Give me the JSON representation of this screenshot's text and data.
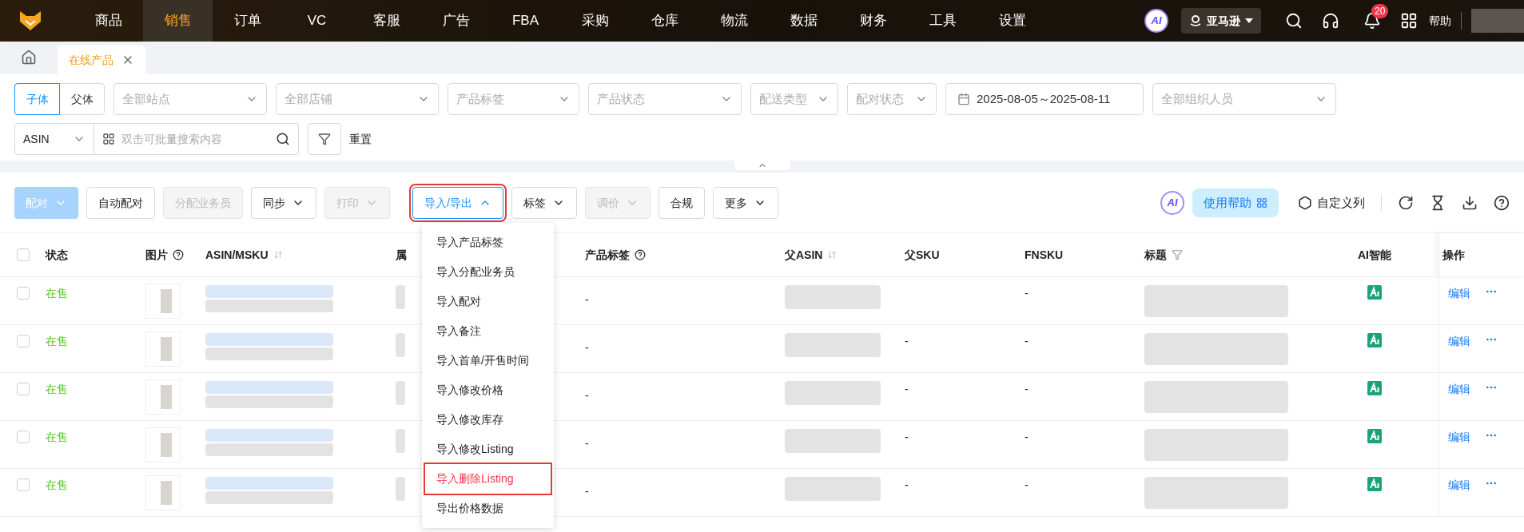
{
  "nav": {
    "items": [
      {
        "label": "商品",
        "selected": false
      },
      {
        "label": "销售",
        "selected": true
      },
      {
        "label": "订单",
        "selected": false
      },
      {
        "label": "VC",
        "selected": false
      },
      {
        "label": "客服",
        "selected": false
      },
      {
        "label": "广告",
        "selected": false
      },
      {
        "label": "FBA",
        "selected": false
      },
      {
        "label": "采购",
        "selected": false
      },
      {
        "label": "仓库",
        "selected": false
      },
      {
        "label": "物流",
        "selected": false
      },
      {
        "label": "数据",
        "selected": false
      },
      {
        "label": "财务",
        "selected": false
      },
      {
        "label": "工具",
        "selected": false
      },
      {
        "label": "设置",
        "selected": false
      }
    ],
    "ai_badge": "AI",
    "marketplace": "亚马逊",
    "notification_count": "20",
    "help": "帮助"
  },
  "tabs": [
    {
      "label": "在线产品",
      "selected": true
    }
  ],
  "filters": {
    "view_toggle": [
      {
        "label": "子体",
        "selected": true
      },
      {
        "label": "父体",
        "selected": false
      }
    ],
    "row1": [
      {
        "kind": "select",
        "placeholder": "全部站点"
      },
      {
        "kind": "select",
        "placeholder": "全部店铺"
      },
      {
        "kind": "select",
        "placeholder": "产品标签"
      },
      {
        "kind": "select",
        "placeholder": "产品状态"
      },
      {
        "kind": "select",
        "placeholder": "配送类型"
      },
      {
        "kind": "select",
        "placeholder": "配对状态"
      },
      {
        "kind": "date",
        "value": "2025-08-05～2025-08-11"
      },
      {
        "kind": "select",
        "placeholder": "全部组织人员"
      }
    ],
    "search_field": "ASIN",
    "search_placeholder": "双击可批量搜索内容",
    "reset": "重置"
  },
  "toolbar": {
    "buttons": [
      {
        "label": "配对",
        "kind": "primary",
        "disabled": true,
        "dropdown": true,
        "expanded": false,
        "highlighted": false
      },
      {
        "label": "自动配对",
        "kind": "default",
        "disabled": false,
        "dropdown": false,
        "expanded": false,
        "highlighted": false
      },
      {
        "label": "分配业务员",
        "kind": "default",
        "disabled": true,
        "dropdown": false,
        "expanded": false,
        "highlighted": false
      },
      {
        "label": "同步",
        "kind": "default",
        "disabled": false,
        "dropdown": true,
        "expanded": false,
        "highlighted": false
      },
      {
        "label": "打印",
        "kind": "default",
        "disabled": true,
        "dropdown": true,
        "expanded": false,
        "highlighted": false
      },
      {
        "label": "导入/导出",
        "kind": "default",
        "disabled": false,
        "dropdown": true,
        "expanded": true,
        "highlighted": true
      },
      {
        "label": "标签",
        "kind": "default",
        "disabled": false,
        "dropdown": true,
        "expanded": false,
        "highlighted": false
      },
      {
        "label": "调价",
        "kind": "default",
        "disabled": true,
        "dropdown": true,
        "expanded": false,
        "highlighted": false
      },
      {
        "label": "合规",
        "kind": "default",
        "disabled": false,
        "dropdown": false,
        "expanded": false,
        "highlighted": false
      },
      {
        "label": "更多",
        "kind": "default",
        "disabled": false,
        "dropdown": true,
        "expanded": false,
        "highlighted": false
      }
    ],
    "ai_badge": "AI",
    "help_button": "使用帮助",
    "custom_columns": "自定义列"
  },
  "menu": {
    "items": [
      {
        "label": "导入产品标签",
        "highlighted": false
      },
      {
        "label": "导入分配业务员",
        "highlighted": false
      },
      {
        "label": "导入配对",
        "highlighted": false
      },
      {
        "label": "导入备注",
        "highlighted": false
      },
      {
        "label": "导入首单/开售时间",
        "highlighted": false
      },
      {
        "label": "导入修改价格",
        "highlighted": false
      },
      {
        "label": "导入修改库存",
        "highlighted": false
      },
      {
        "label": "导入修改Listing",
        "highlighted": false
      },
      {
        "label": "导入删除Listing",
        "highlighted": true
      },
      {
        "label": "导出价格数据",
        "highlighted": false
      }
    ]
  },
  "table": {
    "select_all_checked": false,
    "columns": [
      {
        "label": "状态",
        "kind": "plain"
      },
      {
        "label": "图片",
        "kind": "help"
      },
      {
        "label": "ASIN/MSKU",
        "kind": "sortable"
      },
      {
        "label": "属",
        "kind": "plain"
      },
      {
        "label": "产品标签",
        "kind": "help"
      },
      {
        "label": "父ASIN",
        "kind": "sortable"
      },
      {
        "label": "父SKU",
        "kind": "plain"
      },
      {
        "label": "FNSKU",
        "kind": "plain"
      },
      {
        "label": "标题",
        "kind": "filterable"
      },
      {
        "label": "AI智能",
        "kind": "plain"
      },
      {
        "label": "操作",
        "kind": "plain"
      }
    ],
    "rows": [
      {
        "checked": false,
        "status": "在售",
        "product_tag": "-",
        "fnsku": "-",
        "action": "编辑"
      },
      {
        "checked": false,
        "status": "在售",
        "product_tag": "-",
        "parent_sku": "-",
        "fnsku": "-",
        "action": "编辑"
      },
      {
        "checked": false,
        "status": "在售",
        "product_tag": "-",
        "parent_sku": "-",
        "fnsku": "-",
        "action": "编辑"
      },
      {
        "checked": false,
        "status": "在售",
        "product_tag": "-",
        "parent_sku": "-",
        "fnsku": "-",
        "action": "编辑"
      },
      {
        "checked": false,
        "status": "在售",
        "product_tag": "-",
        "parent_sku": "-",
        "fnsku": "-",
        "action": "编辑"
      }
    ]
  }
}
